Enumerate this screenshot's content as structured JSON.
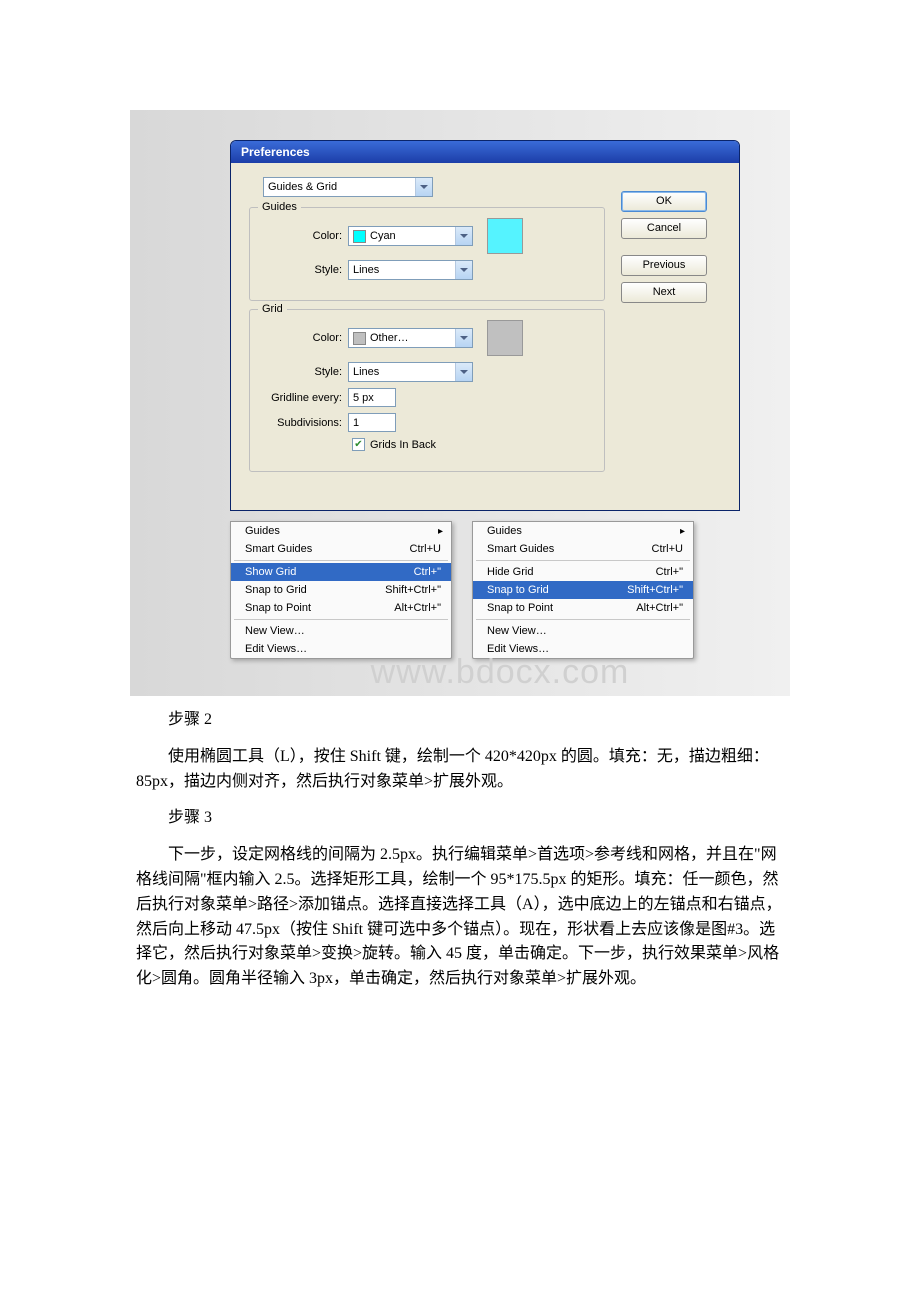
{
  "dialog": {
    "title": "Preferences",
    "category": "Guides & Grid",
    "guides": {
      "legend": "Guides",
      "colorLabel": "Color:",
      "colorValue": "Cyan",
      "styleLabel": "Style:",
      "styleValue": "Lines"
    },
    "grid": {
      "legend": "Grid",
      "colorLabel": "Color:",
      "colorValue": "Other…",
      "styleLabel": "Style:",
      "styleValue": "Lines",
      "gridlineLabel": "Gridline every:",
      "gridlineValue": "5 px",
      "subdivLabel": "Subdivisions:",
      "subdivValue": "1",
      "gridsInBack": "Grids In Back"
    },
    "buttons": {
      "ok": "OK",
      "cancel": "Cancel",
      "previous": "Previous",
      "next": "Next"
    }
  },
  "menu": {
    "items": [
      {
        "label": "Guides",
        "shortcut": "",
        "sub": true
      },
      {
        "label": "Smart Guides",
        "shortcut": "Ctrl+U"
      },
      {
        "label": "Show Grid",
        "shortcut": "Ctrl+\""
      },
      {
        "label": "Hide Grid",
        "shortcut": "Ctrl+\""
      },
      {
        "label": "Snap to Grid",
        "shortcut": "Shift+Ctrl+\""
      },
      {
        "label": "Snap to Point",
        "shortcut": "Alt+Ctrl+\""
      },
      {
        "label": "New View…",
        "shortcut": ""
      },
      {
        "label": "Edit Views…",
        "shortcut": ""
      }
    ]
  },
  "watermark": "www.bdocx.com",
  "text": {
    "s2": "步骤 2",
    "p2": "使用椭圆工具（L），按住 Shift 键，绘制一个 420*420px 的圆。填充：无，描边粗细：85px，描边内侧对齐，然后执行对象菜单>扩展外观。",
    "s3": "步骤 3",
    "p3": "下一步，设定网格线的间隔为 2.5px。执行编辑菜单>首选项>参考线和网格，并且在\"网格线间隔\"框内输入 2.5。选择矩形工具，绘制一个 95*175.5px 的矩形。填充：任一颜色，然后执行对象菜单>路径>添加锚点。选择直接选择工具（A），选中底边上的左锚点和右锚点，然后向上移动 47.5px（按住 Shift 键可选中多个锚点）。现在，形状看上去应该像是图#3。选择它，然后执行对象菜单>变换>旋转。输入 45 度，单击确定。下一步，执行效果菜单>风格化>圆角。圆角半径输入 3px，单击确定，然后执行对象菜单>扩展外观。"
  }
}
